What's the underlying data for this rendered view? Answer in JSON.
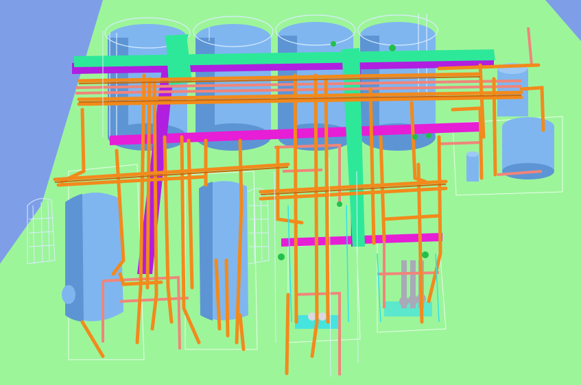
{
  "scene": {
    "description_visible_text": "",
    "colors": {
      "background_sky": "#7f9ee8",
      "ground": "#9df59a",
      "ground_edge": "#8ee889",
      "process_pipe": "#f28a1c",
      "process_pipe_dark": "#c8680c",
      "utility_pipe": "#f0857a",
      "header_duct": "#b01ee0",
      "rack_beam": "#e61ed6",
      "air_duct": "#2ee89a",
      "vessel": "#7fb6f0",
      "vessel_shade": "#5d95d4",
      "handrail": "#d9ecff",
      "foundation": "#d8f5d6",
      "instrument_cyan": "#30e0f0",
      "valve_green": "#22c04a",
      "pump_grey": "#a9a9b8"
    },
    "objects": {
      "storage_tanks": 4,
      "large_vessels": 2,
      "small_vessels": 3,
      "pump_skids": 2
    }
  }
}
